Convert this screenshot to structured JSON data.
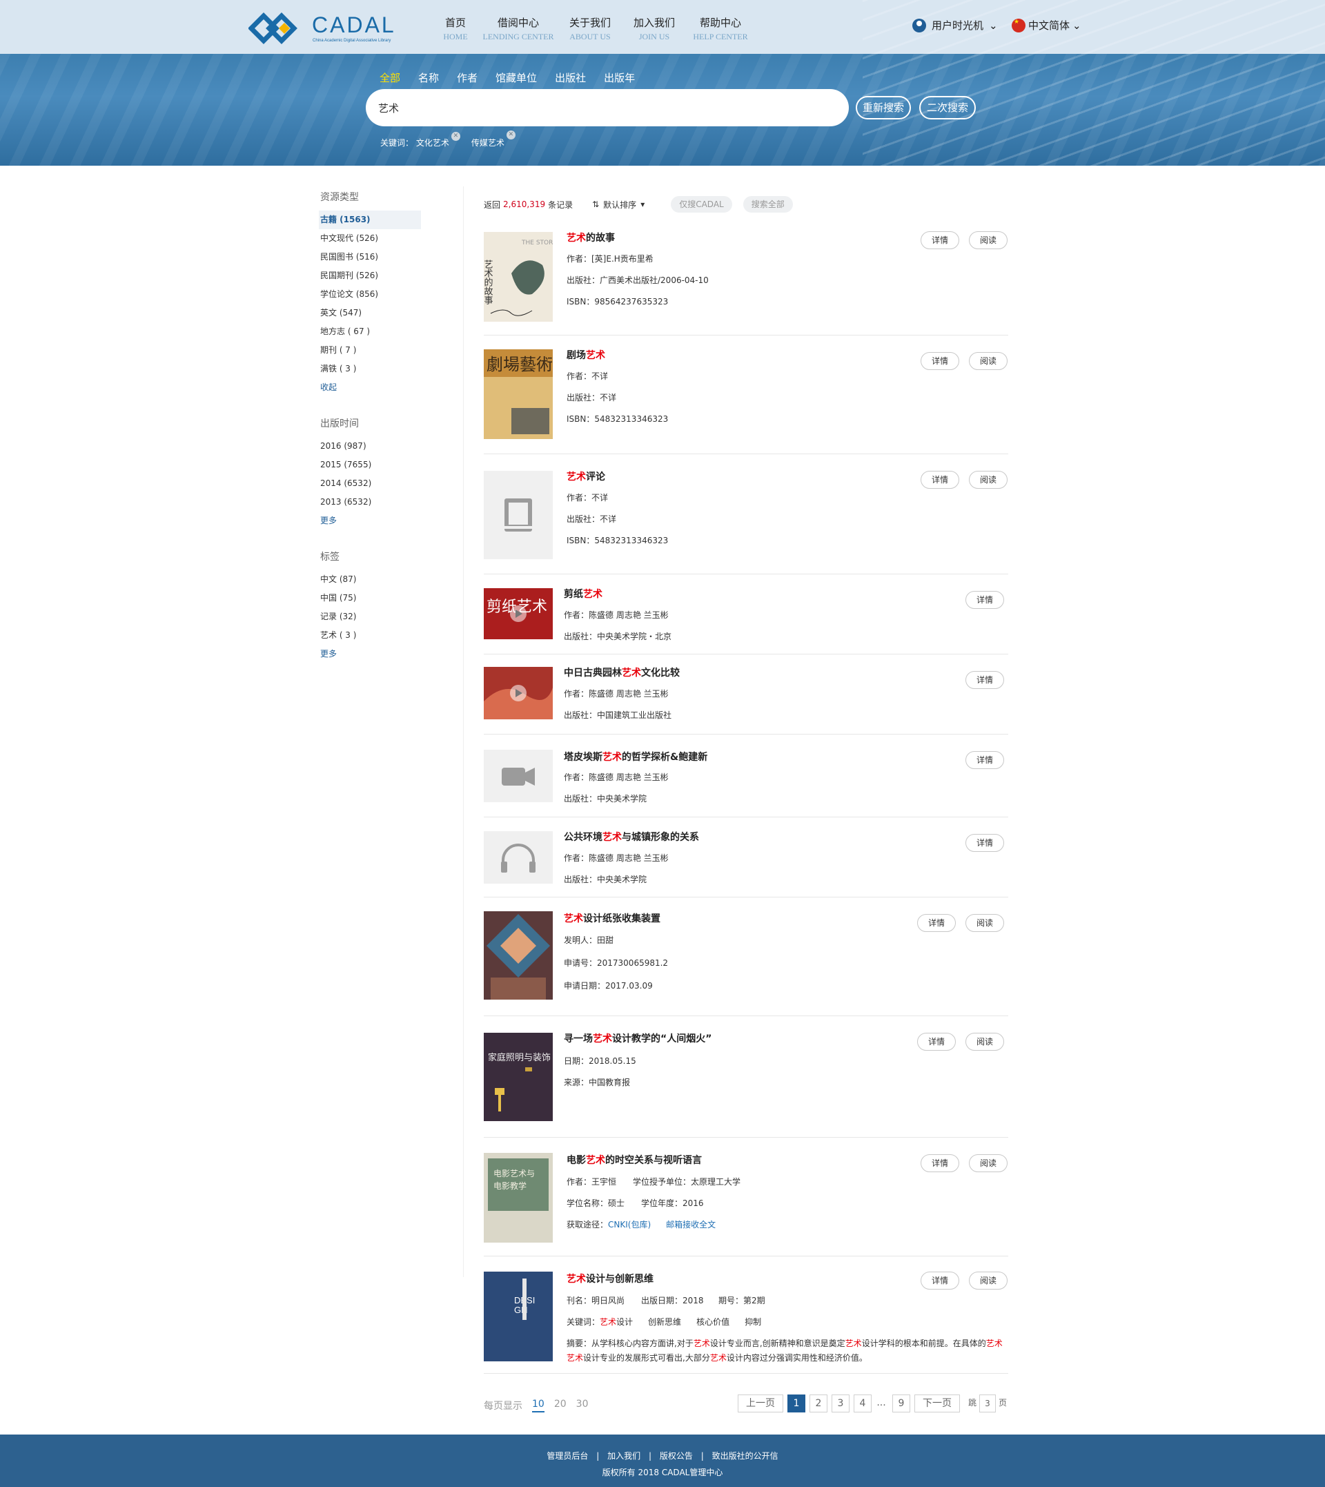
{
  "header": {
    "logo_text": "CADAL",
    "logo_sub": "China Academic Digital Associative Library",
    "nav": [
      {
        "cn": "首页",
        "en": "HOME"
      },
      {
        "cn": "借阅中心",
        "en": "LENDING CENTER"
      },
      {
        "cn": "关于我们",
        "en": "ABOUT US"
      },
      {
        "cn": "加入我们",
        "en": "JOIN US"
      },
      {
        "cn": "帮助中心",
        "en": "HELP CENTER"
      }
    ],
    "user": "用户时光机",
    "lang": "中文简体"
  },
  "search": {
    "tabs": [
      "全部",
      "名称",
      "作者",
      "馆藏单位",
      "出版社",
      "出版年"
    ],
    "active_tab": "全部",
    "query": "艺术",
    "research_btn": "重新搜索",
    "secondary_btn": "二次搜索",
    "keywords_label": "关键词：",
    "keywords": [
      "文化艺术",
      "传媒艺术"
    ]
  },
  "sidebar": {
    "type_title": "资源类型",
    "types": [
      "古籍 (1563)",
      "中文现代 (526)",
      "民国图书 (516)",
      "民国期刊 (526)",
      "学位论文 (856)",
      "英文 (547)",
      "地方志 ( 67 )",
      "期刊 ( 7 )",
      "满铁 ( 3 )"
    ],
    "collapse": "收起",
    "year_title": "出版时间",
    "years": [
      "2016 (987)",
      "2015 (7655)",
      "2014 (6532)",
      "2013 (6532)"
    ],
    "year_more": "更多",
    "tag_title": "标签",
    "tags": [
      "中文 (87)",
      "中国 (75)",
      "记录 (32)",
      "艺术 ( 3 )"
    ],
    "tag_more": "更多"
  },
  "results": {
    "prefix": "返回",
    "count": "2,610,319",
    "suffix": "条记录",
    "sort": "默认排序",
    "only_cadal": "仅搜CADAL",
    "search_all": "搜索全部",
    "detail": "详情",
    "read": "阅读",
    "items": [
      {
        "t": [
          "",
          "艺术",
          "的故事"
        ],
        "lines": [
          "作者：[英]E.H贡布里希",
          "出版社：广西美术出版社/2006-04-10",
          "ISBN：98564237635323"
        ]
      },
      {
        "t": [
          "剧场",
          "艺术",
          ""
        ],
        "lines": [
          "作者：不详",
          "出版社：不详",
          "ISBN：54832313346323"
        ]
      },
      {
        "t": [
          "",
          "艺术",
          "评论"
        ],
        "lines": [
          "作者：不详",
          "出版社：不详",
          "ISBN：54832313346323"
        ]
      },
      {
        "t": [
          "剪纸",
          "艺术",
          ""
        ],
        "lines": [
          "作者：陈盛德 周志艳 兰玉彬",
          "出版社：中央美术学院・北京"
        ]
      },
      {
        "t": [
          "中日古典园林",
          "艺术",
          "文化比较"
        ],
        "lines": [
          "作者：陈盛德 周志艳 兰玉彬",
          "出版社：中国建筑工业出版社"
        ]
      },
      {
        "t": [
          "塔皮埃斯",
          "艺术",
          "的哲学探析&鲍建新"
        ],
        "lines": [
          "作者：陈盛德 周志艳 兰玉彬",
          "出版社：中央美术学院"
        ]
      },
      {
        "t": [
          "公共环境",
          "艺术",
          "与城镇形象的关系"
        ],
        "lines": [
          "作者：陈盛德 周志艳 兰玉彬",
          "出版社：中央美术学院"
        ]
      },
      {
        "t": [
          "",
          "艺术",
          "设计纸张收集装置"
        ],
        "lines": [
          "发明人：田甜",
          "申请号：201730065981.2",
          "申请日期：2017.03.09"
        ]
      },
      {
        "t": [
          "寻一场",
          "艺术",
          "设计教学的“人间烟火”"
        ],
        "lines": [
          "日期：2018.05.15",
          "来源：中国教育报"
        ]
      },
      {
        "t": [
          "电影",
          "艺术",
          "的时空关系与视听语言"
        ],
        "lines": [
          "作者：王宇恒",
          "学位授予单位：太原理工大学",
          "学位名称：硕士",
          "学位年度：2016",
          "获取途径：",
          "CNKI(包库)",
          "邮箱接收全文"
        ]
      },
      {
        "t": [
          "",
          "艺术",
          "设计与创新思维"
        ],
        "lines": [
          "刊名：明日风尚",
          "出版日期：2018",
          "期号：第2期",
          "关键词：",
          "艺术",
          "设计",
          "创新思维",
          "核心价值",
          "抑制"
        ],
        "abstract": [
          "摘要：从学科核心内容方面讲,对于",
          "艺术",
          "设计专业而言,创新精神和意识是奠定",
          "艺术",
          "设计学科的根本和前提。在具体的",
          "艺术",
          "艺术",
          "设计专业的发展形式可看出,大部分",
          "艺术",
          "设计内容过分强调实用性和经济价值。"
        ]
      }
    ]
  },
  "pager": {
    "per_page_label": "每页显示",
    "per_page": [
      "10",
      "20",
      "30"
    ],
    "prev": "上一页",
    "pages": [
      "1",
      "2",
      "3",
      "4",
      "...",
      "9"
    ],
    "next": "下一页",
    "jump": "跳",
    "jump_val": "3",
    "page_unit": "页"
  },
  "footer": {
    "links": [
      "管理员后台",
      "加入我们",
      "版权公告",
      "致出版社的公开信"
    ],
    "sep": "|",
    "copyright": "版权所有 2018 CADAL管理中心"
  }
}
